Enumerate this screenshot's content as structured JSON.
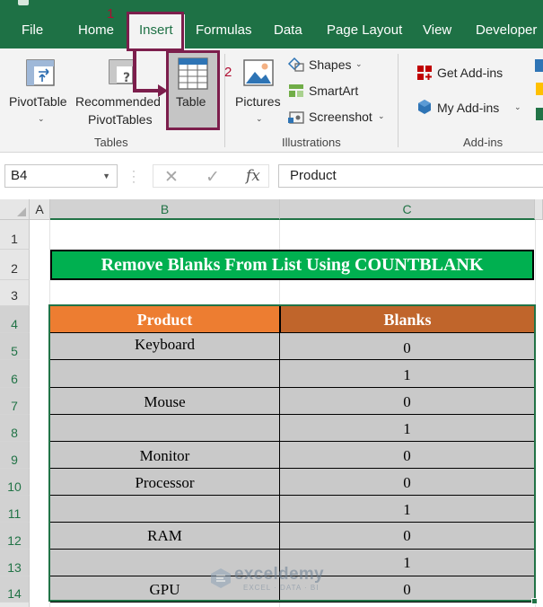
{
  "tabs": [
    "File",
    "Home",
    "Insert",
    "Formulas",
    "Data",
    "Page Layout",
    "View",
    "Developer"
  ],
  "active_tab": "Insert",
  "annotations": {
    "step1": "1",
    "step2": "2"
  },
  "ribbon": {
    "tables_group": {
      "label": "Tables",
      "pivottable": "PivotTable",
      "recommended_line1": "Recommended",
      "recommended_line2": "PivotTables",
      "table": "Table"
    },
    "illustrations_group": {
      "label": "Illustrations",
      "pictures": "Pictures",
      "shapes": "Shapes",
      "smartart": "SmartArt",
      "screenshot": "Screenshot"
    },
    "addins_group": {
      "label": "Add-ins",
      "get_addins": "Get Add-ins",
      "my_addins": "My Add-ins"
    }
  },
  "formula_bar": {
    "name_box": "B4",
    "cancel_glyph": "✕",
    "enter_glyph": "✓",
    "fx": "fx",
    "formula": "Product"
  },
  "columns": [
    "A",
    "B",
    "C"
  ],
  "rows": [
    "1",
    "2",
    "3",
    "4",
    "5",
    "6",
    "7",
    "8",
    "9",
    "10",
    "11",
    "12",
    "13",
    "14"
  ],
  "sheet": {
    "title": "Remove Blanks From List Using COUNTBLANK",
    "headers": {
      "product": "Product",
      "blanks": "Blanks"
    },
    "data": [
      {
        "product": "Keyboard",
        "blanks": "0"
      },
      {
        "product": "",
        "blanks": "1"
      },
      {
        "product": "Mouse",
        "blanks": "0"
      },
      {
        "product": "",
        "blanks": "1"
      },
      {
        "product": "Monitor",
        "blanks": "0"
      },
      {
        "product": "Processor",
        "blanks": "0"
      },
      {
        "product": "",
        "blanks": "1"
      },
      {
        "product": "RAM",
        "blanks": "0"
      },
      {
        "product": "",
        "blanks": "1"
      },
      {
        "product": "GPU",
        "blanks": "0"
      }
    ]
  },
  "watermark": {
    "brand": "exceldemy",
    "tagline": "EXCEL · DATA · BI"
  },
  "colors": {
    "excel_green": "#1e7145",
    "title_fill": "#00b050",
    "product_header": "#ed7d31",
    "blanks_header": "#c0652b",
    "row_fill": "#c9c9c9",
    "highlight": "#7c1e4c",
    "annotation": "#b00d31"
  }
}
